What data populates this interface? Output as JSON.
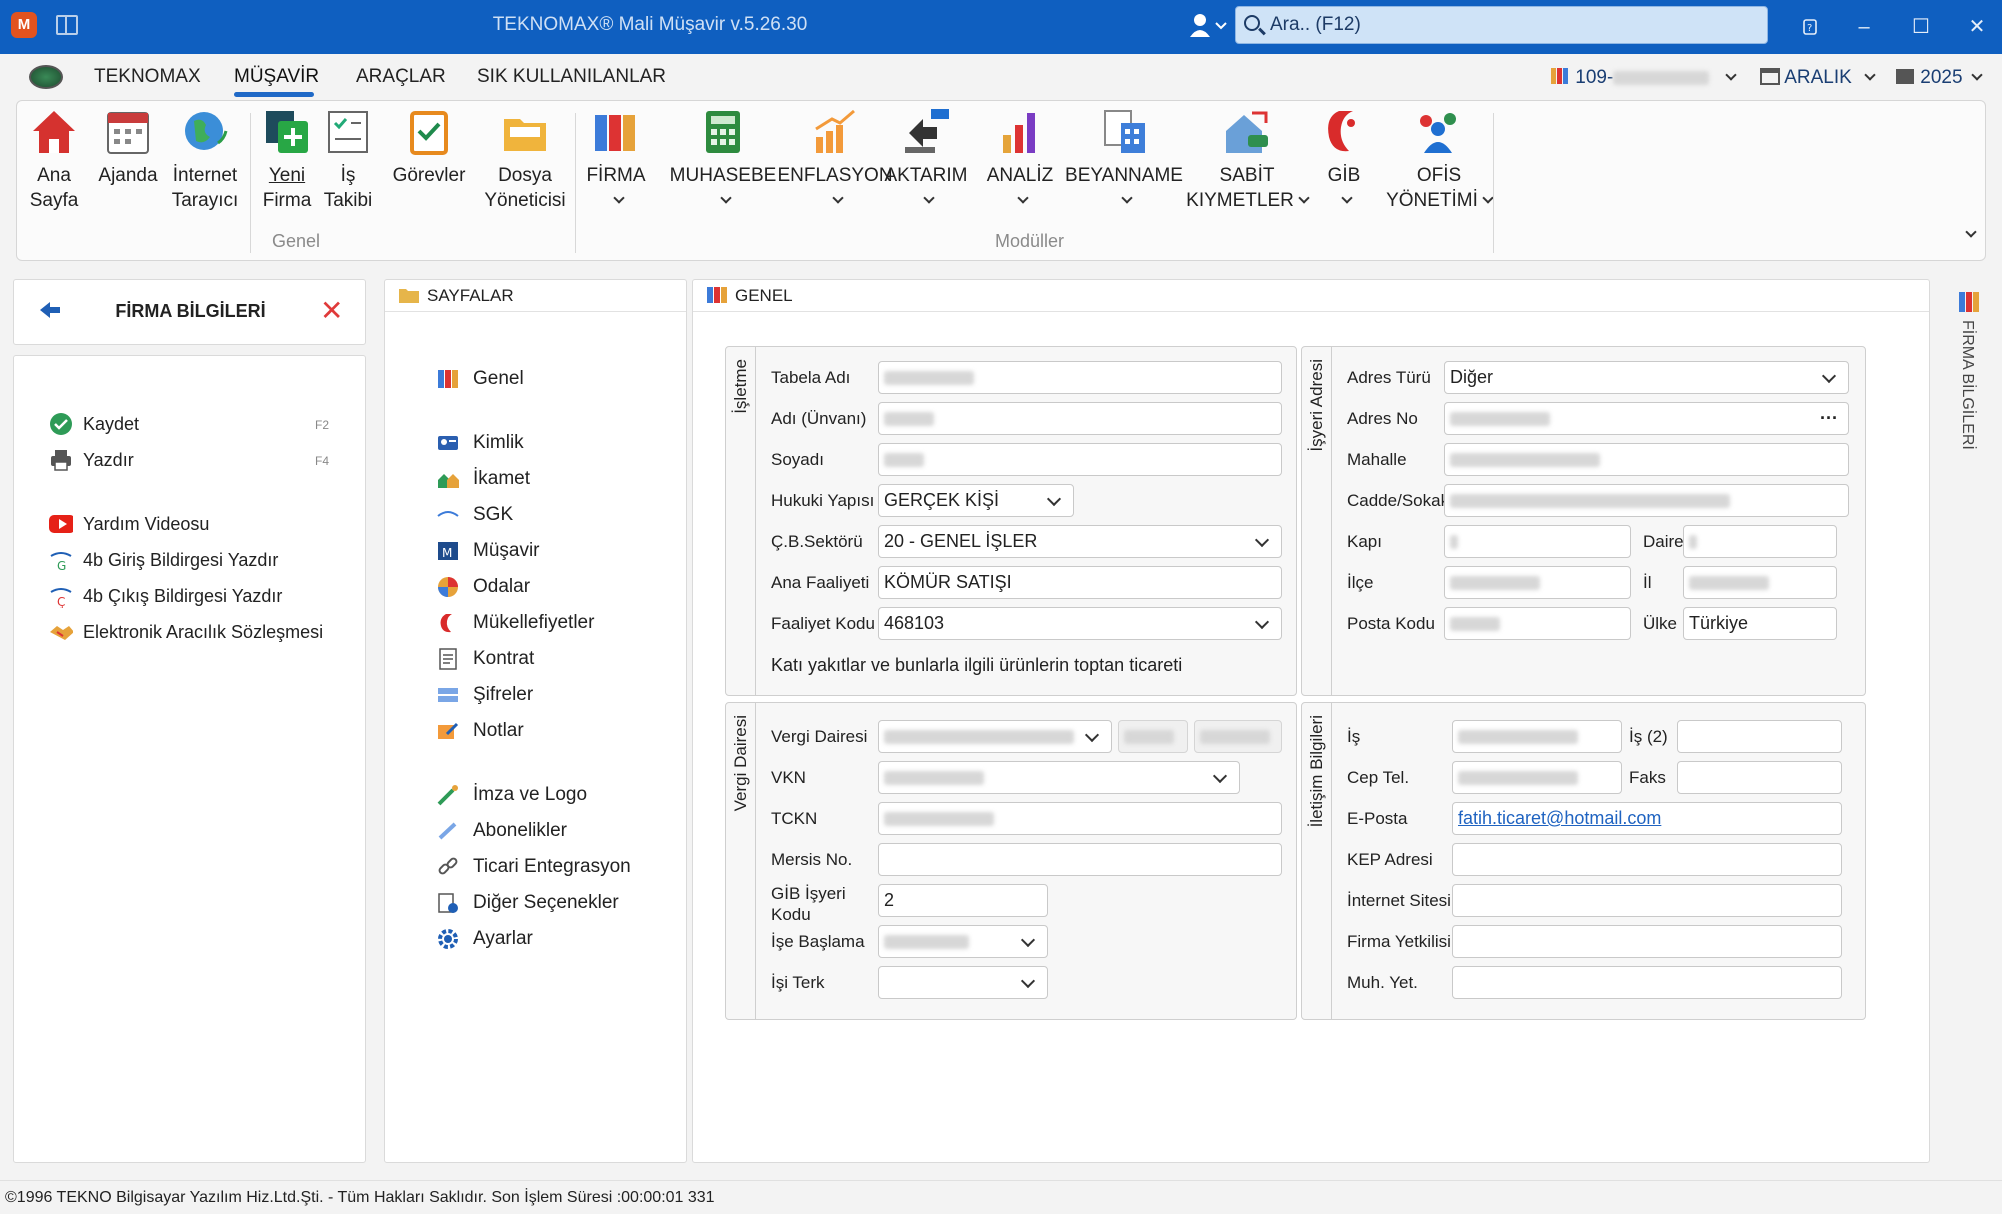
{
  "window": {
    "title": "TEKNOMAX® Mali Müşavir v.5.26.30",
    "search_placeholder": "Ara.. (F12)",
    "logo_letter": "M"
  },
  "menu": {
    "tabs": [
      "TEKNOMAX",
      "MÜŞAVİR",
      "ARAÇLAR",
      "SIK KULLANILANLAR"
    ],
    "active": "MÜŞAVİR",
    "firm_selector": "109-",
    "month_selector": "ARALIK",
    "year_selector": "2025"
  },
  "ribbon": {
    "genel": [
      {
        "label1": "Ana",
        "label2": "Sayfa",
        "icon": "house-icon"
      },
      {
        "label1": "Ajanda",
        "label2": "",
        "icon": "calendar-icon"
      },
      {
        "label1": "İnternet",
        "label2": "Tarayıcı",
        "icon": "globe-icon"
      },
      {
        "label1": "Yeni",
        "label2": "Firma",
        "icon": "new-firm-icon"
      },
      {
        "label1": "İş",
        "label2": "Takibi",
        "icon": "task-tracking-icon"
      },
      {
        "label1": "Görevler",
        "label2": "",
        "icon": "tasks-icon"
      },
      {
        "label1": "Dosya",
        "label2": "Yöneticisi",
        "icon": "folder-icon"
      }
    ],
    "moduller": [
      {
        "label1": "FİRMA",
        "label2": "",
        "icon": "binders-icon"
      },
      {
        "label1": "MUHASEBE",
        "label2": "",
        "icon": "calculator-icon"
      },
      {
        "label1": "ENFLASYON",
        "label2": "",
        "icon": "inflation-icon"
      },
      {
        "label1": "AKTARIM",
        "label2": "",
        "icon": "transfer-icon"
      },
      {
        "label1": "ANALİZ",
        "label2": "",
        "icon": "bar-chart-icon"
      },
      {
        "label1": "BEYANNAME",
        "label2": "",
        "icon": "declaration-icon"
      },
      {
        "label1": "SABİT",
        "label2": "KIYMETLER",
        "icon": "fixed-assets-icon"
      },
      {
        "label1": "GİB",
        "label2": "",
        "icon": "gib-icon"
      },
      {
        "label1": "OFİS",
        "label2": "YÖNETİMİ",
        "icon": "office-mgmt-icon"
      }
    ],
    "group_genel": "Genel",
    "group_moduller": "Modüller"
  },
  "left_panel": {
    "title": "FİRMA BİLGİLERİ",
    "items": [
      {
        "label": "Kaydet",
        "key": "F2"
      },
      {
        "label": "Yazdır",
        "key": "F4"
      },
      {
        "label": "Yardım Videosu",
        "key": ""
      },
      {
        "label": "4b Giriş Bildirgesi Yazdır",
        "key": ""
      },
      {
        "label": "4b Çıkış Bildirgesi Yazdır",
        "key": ""
      },
      {
        "label": "Elektronik Aracılık Sözleşmesi",
        "key": ""
      }
    ]
  },
  "pages": {
    "title": "SAYFALAR",
    "items": [
      "Genel",
      "Kimlik",
      "İkamet",
      "SGK",
      "Müşavir",
      "Odalar",
      "Mükellefiyetler",
      "Kontrat",
      "Şifreler",
      "Notlar",
      "İmza ve Logo",
      "Abonelikler",
      "Ticari Entegrasyon",
      "Diğer Seçenekler",
      "Ayarlar"
    ]
  },
  "main": {
    "title": "GENEL",
    "isletme": {
      "legend": "İşletme",
      "tabela_label": "Tabela Adı",
      "adi_label": "Adı (Ünvanı)",
      "soyadi_label": "Soyadı",
      "hukuki_label": "Hukuki Yapısı",
      "hukuki_value": "GERÇEK KİŞİ",
      "sektor_label": "Ç.B.Sektörü",
      "sektor_value": "20 - GENEL İŞLER",
      "faaliyet_label": "Ana Faaliyeti",
      "faaliyet_value": "KÖMÜR SATIŞI",
      "kod_label": "Faaliyet Kodu",
      "kod_value": "468103",
      "kod_desc": "Katı yakıtlar ve bunlarla ilgili ürünlerin toptan ticareti"
    },
    "adres": {
      "legend": "İşyeri Adresi",
      "tur_label": "Adres Türü",
      "tur_value": "Diğer",
      "no_label": "Adres No",
      "no_btn": "···",
      "mahalle_label": "Mahalle",
      "cadde_label": "Cadde/Sokak",
      "kapi_label": "Kapı",
      "daire_label": "Daire",
      "ilce_label": "İlçe",
      "il_label": "İl",
      "posta_label": "Posta Kodu",
      "ulke_label": "Ülke",
      "ulke_value": "Türkiye"
    },
    "vergi": {
      "legend": "Vergi Dairesi",
      "vd_label": "Vergi Dairesi",
      "vkn_label": "VKN",
      "tckn_label": "TCKN",
      "mersis_label": "Mersis No.",
      "gib_label1": "GİB İşyeri",
      "gib_label2": "Kodu",
      "gib_value": "2",
      "baslama_label": "İşe Başlama",
      "terk_label": "İşi Terk"
    },
    "iletisim": {
      "legend": "İletişim Bilgileri",
      "is_label": "İş",
      "is2_label": "İş (2)",
      "cep_label": "Cep Tel.",
      "faks_label": "Faks",
      "eposta_label": "E-Posta",
      "eposta_value": "fatih.ticaret@hotmail.com",
      "kep_label": "KEP Adresi",
      "web_label": "İnternet Sitesi",
      "yetkili_label": "Firma Yetkilisi",
      "muh_label": "Muh. Yet."
    }
  },
  "right_side": {
    "label": "FİRMA BİLGİLERİ"
  },
  "status": {
    "text": "©1996 TEKNO Bilgisayar Yazılım Hiz.Ltd.Şti. - Tüm Hakları Saklıdır.   Son İşlem Süresi :00:00:01 331"
  }
}
